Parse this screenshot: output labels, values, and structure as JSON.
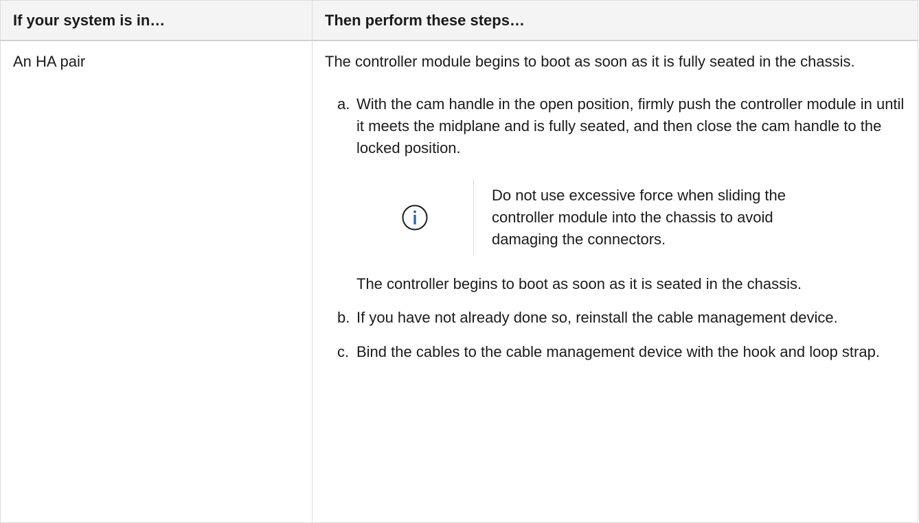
{
  "table": {
    "headers": [
      "If your system is in…",
      "Then perform these steps…"
    ],
    "row": {
      "condition": "An HA pair",
      "intro": "The controller module begins to boot as soon as it is fully seated in the chassis.",
      "steps": [
        {
          "marker": "a.",
          "text": "With the cam handle in the open position, firmly push the controller module in until it meets the midplane and is fully seated, and then close the cam handle to the locked position.",
          "note": {
            "icon": "info-icon",
            "text": "Do not use excessive force when sliding the controller module into the chassis to avoid damaging the connectors."
          },
          "after_note": "The controller begins to boot as soon as it is seated in the chassis."
        },
        {
          "marker": "b.",
          "text": "If you have not already done so, reinstall the cable management device."
        },
        {
          "marker": "c.",
          "text": "Bind the cables to the cable management device with the hook and loop strap."
        }
      ]
    }
  },
  "colors": {
    "info_icon": "#1a63b8",
    "border": "#dcdcdc",
    "header_bg": "#f4f4f4"
  }
}
